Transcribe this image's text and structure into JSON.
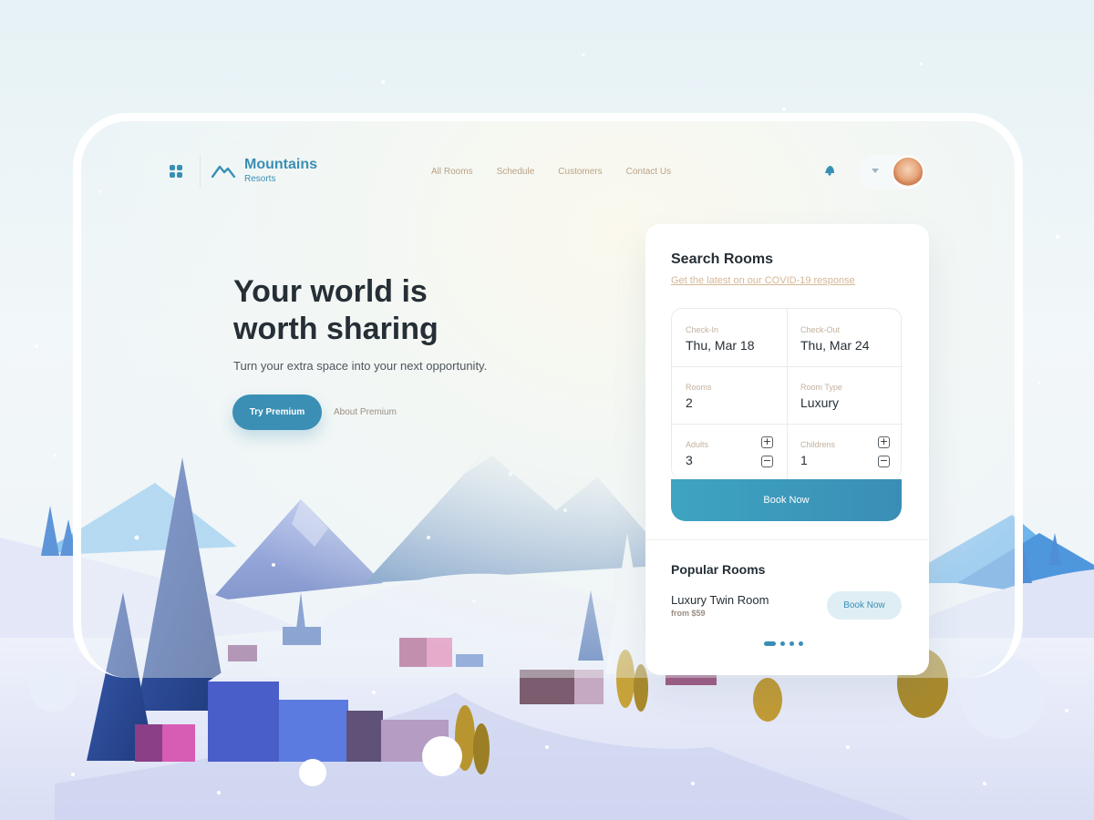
{
  "brand": {
    "name": "Mountains",
    "sub": "Resorts"
  },
  "nav": [
    "All Rooms",
    "Schedule",
    "Customers",
    "Contact Us"
  ],
  "icons": {
    "menu": "grid-menu-icon",
    "logo": "mountain-logo-icon",
    "notification": "bell-icon",
    "dropdown": "chevron-down-icon"
  },
  "hero": {
    "title_line1": "Your world is",
    "title_line2": "worth sharing",
    "subtitle": "Turn your extra space into your next opportunity.",
    "primary_button": "Try Premium",
    "secondary_link": "About Premium"
  },
  "search": {
    "title": "Search Rooms",
    "covid_link": "Get the latest on our COVID-19 response",
    "checkin": {
      "label": "Check-In",
      "value": "Thu, Mar 18"
    },
    "checkout": {
      "label": "Check-Out",
      "value": "Thu, Mar 24"
    },
    "rooms": {
      "label": "Rooms",
      "value": "2"
    },
    "room_type": {
      "label": "Room Type",
      "value": "Luxury"
    },
    "adults": {
      "label": "Adults",
      "value": "3"
    },
    "children": {
      "label": "Childrens",
      "value": "1"
    },
    "plus": "+",
    "minus": "−",
    "book_button": "Book Now"
  },
  "popular": {
    "title": "Popular Rooms",
    "room_name": "Luxury Twin Room",
    "room_price": "from $59",
    "book_button": "Book Now",
    "carousel_pages": 4,
    "active_page": 1
  },
  "colors": {
    "accent": "#3a8fb4",
    "title": "#262f36",
    "nav": "#b9a287",
    "link": "#d6b796"
  }
}
